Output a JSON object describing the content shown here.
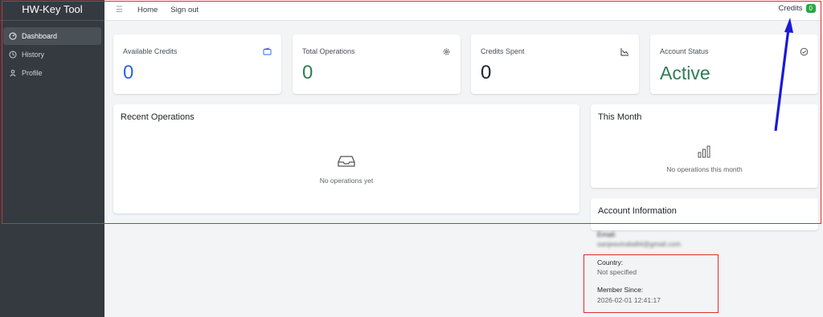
{
  "sidebar": {
    "brand": "HW-Key Tool",
    "items": [
      {
        "label": "Dashboard",
        "icon": "dashboard-icon",
        "active": true
      },
      {
        "label": "History",
        "icon": "history-icon",
        "active": false
      },
      {
        "label": "Profile",
        "icon": "profile-icon",
        "active": false
      }
    ]
  },
  "topbar": {
    "menu_icon": "menu-icon",
    "links": [
      "Home",
      "Sign out"
    ],
    "credits_label": "Credits",
    "credits_count": "0"
  },
  "stats": [
    {
      "label": "Available Credits",
      "value": "0",
      "icon": "wallet-icon",
      "color": "#2f64e6"
    },
    {
      "label": "Total Operations",
      "value": "0",
      "icon": "gear-icon",
      "color": "#2e7d55"
    },
    {
      "label": "Credits Spent",
      "value": "0",
      "icon": "chart-line-icon",
      "color": "#212529"
    },
    {
      "label": "Account Status",
      "value": "Active",
      "icon": "check-circle-icon",
      "color": "#2e7d55"
    }
  ],
  "recent": {
    "title": "Recent Operations",
    "empty": "No operations yet",
    "icon": "inbox-icon"
  },
  "month": {
    "title": "This Month",
    "empty": "No operations this month",
    "icon": "bar-chart-icon"
  },
  "account": {
    "title": "Account Information",
    "email_label": "Email:",
    "email_value": "sanjeevindia84@gmail.com",
    "country_label": "Country:",
    "country_value": "Not specified",
    "member_label": "Member Since:",
    "member_value": "2026-02-01 12:41:17"
  },
  "colors": {
    "sidebar": "#343a40",
    "badge": "#28a745",
    "annotation_red": "#e02b2b",
    "annotation_blue": "#1a1ad6"
  }
}
